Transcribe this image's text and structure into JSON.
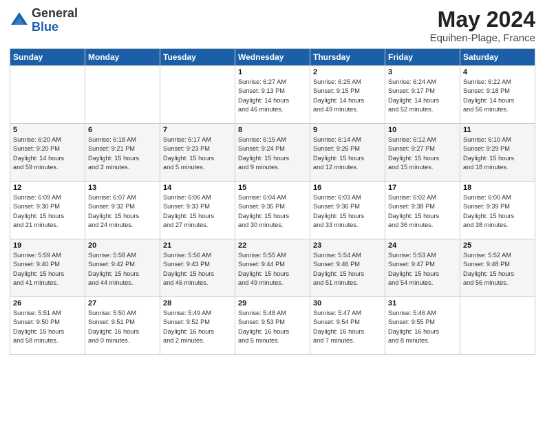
{
  "logo": {
    "general": "General",
    "blue": "Blue"
  },
  "title": "May 2024",
  "subtitle": "Equihen-Plage, France",
  "weekdays": [
    "Sunday",
    "Monday",
    "Tuesday",
    "Wednesday",
    "Thursday",
    "Friday",
    "Saturday"
  ],
  "weeks": [
    [
      {
        "day": "",
        "info": ""
      },
      {
        "day": "",
        "info": ""
      },
      {
        "day": "",
        "info": ""
      },
      {
        "day": "1",
        "info": "Sunrise: 6:27 AM\nSunset: 9:13 PM\nDaylight: 14 hours\nand 46 minutes."
      },
      {
        "day": "2",
        "info": "Sunrise: 6:25 AM\nSunset: 9:15 PM\nDaylight: 14 hours\nand 49 minutes."
      },
      {
        "day": "3",
        "info": "Sunrise: 6:24 AM\nSunset: 9:17 PM\nDaylight: 14 hours\nand 52 minutes."
      },
      {
        "day": "4",
        "info": "Sunrise: 6:22 AM\nSunset: 9:18 PM\nDaylight: 14 hours\nand 56 minutes."
      }
    ],
    [
      {
        "day": "5",
        "info": "Sunrise: 6:20 AM\nSunset: 9:20 PM\nDaylight: 14 hours\nand 59 minutes."
      },
      {
        "day": "6",
        "info": "Sunrise: 6:18 AM\nSunset: 9:21 PM\nDaylight: 15 hours\nand 2 minutes."
      },
      {
        "day": "7",
        "info": "Sunrise: 6:17 AM\nSunset: 9:23 PM\nDaylight: 15 hours\nand 5 minutes."
      },
      {
        "day": "8",
        "info": "Sunrise: 6:15 AM\nSunset: 9:24 PM\nDaylight: 15 hours\nand 9 minutes."
      },
      {
        "day": "9",
        "info": "Sunrise: 6:14 AM\nSunset: 9:26 PM\nDaylight: 15 hours\nand 12 minutes."
      },
      {
        "day": "10",
        "info": "Sunrise: 6:12 AM\nSunset: 9:27 PM\nDaylight: 15 hours\nand 15 minutes."
      },
      {
        "day": "11",
        "info": "Sunrise: 6:10 AM\nSunset: 9:29 PM\nDaylight: 15 hours\nand 18 minutes."
      }
    ],
    [
      {
        "day": "12",
        "info": "Sunrise: 6:09 AM\nSunset: 9:30 PM\nDaylight: 15 hours\nand 21 minutes."
      },
      {
        "day": "13",
        "info": "Sunrise: 6:07 AM\nSunset: 9:32 PM\nDaylight: 15 hours\nand 24 minutes."
      },
      {
        "day": "14",
        "info": "Sunrise: 6:06 AM\nSunset: 9:33 PM\nDaylight: 15 hours\nand 27 minutes."
      },
      {
        "day": "15",
        "info": "Sunrise: 6:04 AM\nSunset: 9:35 PM\nDaylight: 15 hours\nand 30 minutes."
      },
      {
        "day": "16",
        "info": "Sunrise: 6:03 AM\nSunset: 9:36 PM\nDaylight: 15 hours\nand 33 minutes."
      },
      {
        "day": "17",
        "info": "Sunrise: 6:02 AM\nSunset: 9:38 PM\nDaylight: 15 hours\nand 36 minutes."
      },
      {
        "day": "18",
        "info": "Sunrise: 6:00 AM\nSunset: 9:39 PM\nDaylight: 15 hours\nand 38 minutes."
      }
    ],
    [
      {
        "day": "19",
        "info": "Sunrise: 5:59 AM\nSunset: 9:40 PM\nDaylight: 15 hours\nand 41 minutes."
      },
      {
        "day": "20",
        "info": "Sunrise: 5:58 AM\nSunset: 9:42 PM\nDaylight: 15 hours\nand 44 minutes."
      },
      {
        "day": "21",
        "info": "Sunrise: 5:56 AM\nSunset: 9:43 PM\nDaylight: 15 hours\nand 46 minutes."
      },
      {
        "day": "22",
        "info": "Sunrise: 5:55 AM\nSunset: 9:44 PM\nDaylight: 15 hours\nand 49 minutes."
      },
      {
        "day": "23",
        "info": "Sunrise: 5:54 AM\nSunset: 9:46 PM\nDaylight: 15 hours\nand 51 minutes."
      },
      {
        "day": "24",
        "info": "Sunrise: 5:53 AM\nSunset: 9:47 PM\nDaylight: 15 hours\nand 54 minutes."
      },
      {
        "day": "25",
        "info": "Sunrise: 5:52 AM\nSunset: 9:48 PM\nDaylight: 15 hours\nand 56 minutes."
      }
    ],
    [
      {
        "day": "26",
        "info": "Sunrise: 5:51 AM\nSunset: 9:50 PM\nDaylight: 15 hours\nand 58 minutes."
      },
      {
        "day": "27",
        "info": "Sunrise: 5:50 AM\nSunset: 9:51 PM\nDaylight: 16 hours\nand 0 minutes."
      },
      {
        "day": "28",
        "info": "Sunrise: 5:49 AM\nSunset: 9:52 PM\nDaylight: 16 hours\nand 2 minutes."
      },
      {
        "day": "29",
        "info": "Sunrise: 5:48 AM\nSunset: 9:53 PM\nDaylight: 16 hours\nand 5 minutes."
      },
      {
        "day": "30",
        "info": "Sunrise: 5:47 AM\nSunset: 9:54 PM\nDaylight: 16 hours\nand 7 minutes."
      },
      {
        "day": "31",
        "info": "Sunrise: 5:46 AM\nSunset: 9:55 PM\nDaylight: 16 hours\nand 8 minutes."
      },
      {
        "day": "",
        "info": ""
      }
    ]
  ]
}
